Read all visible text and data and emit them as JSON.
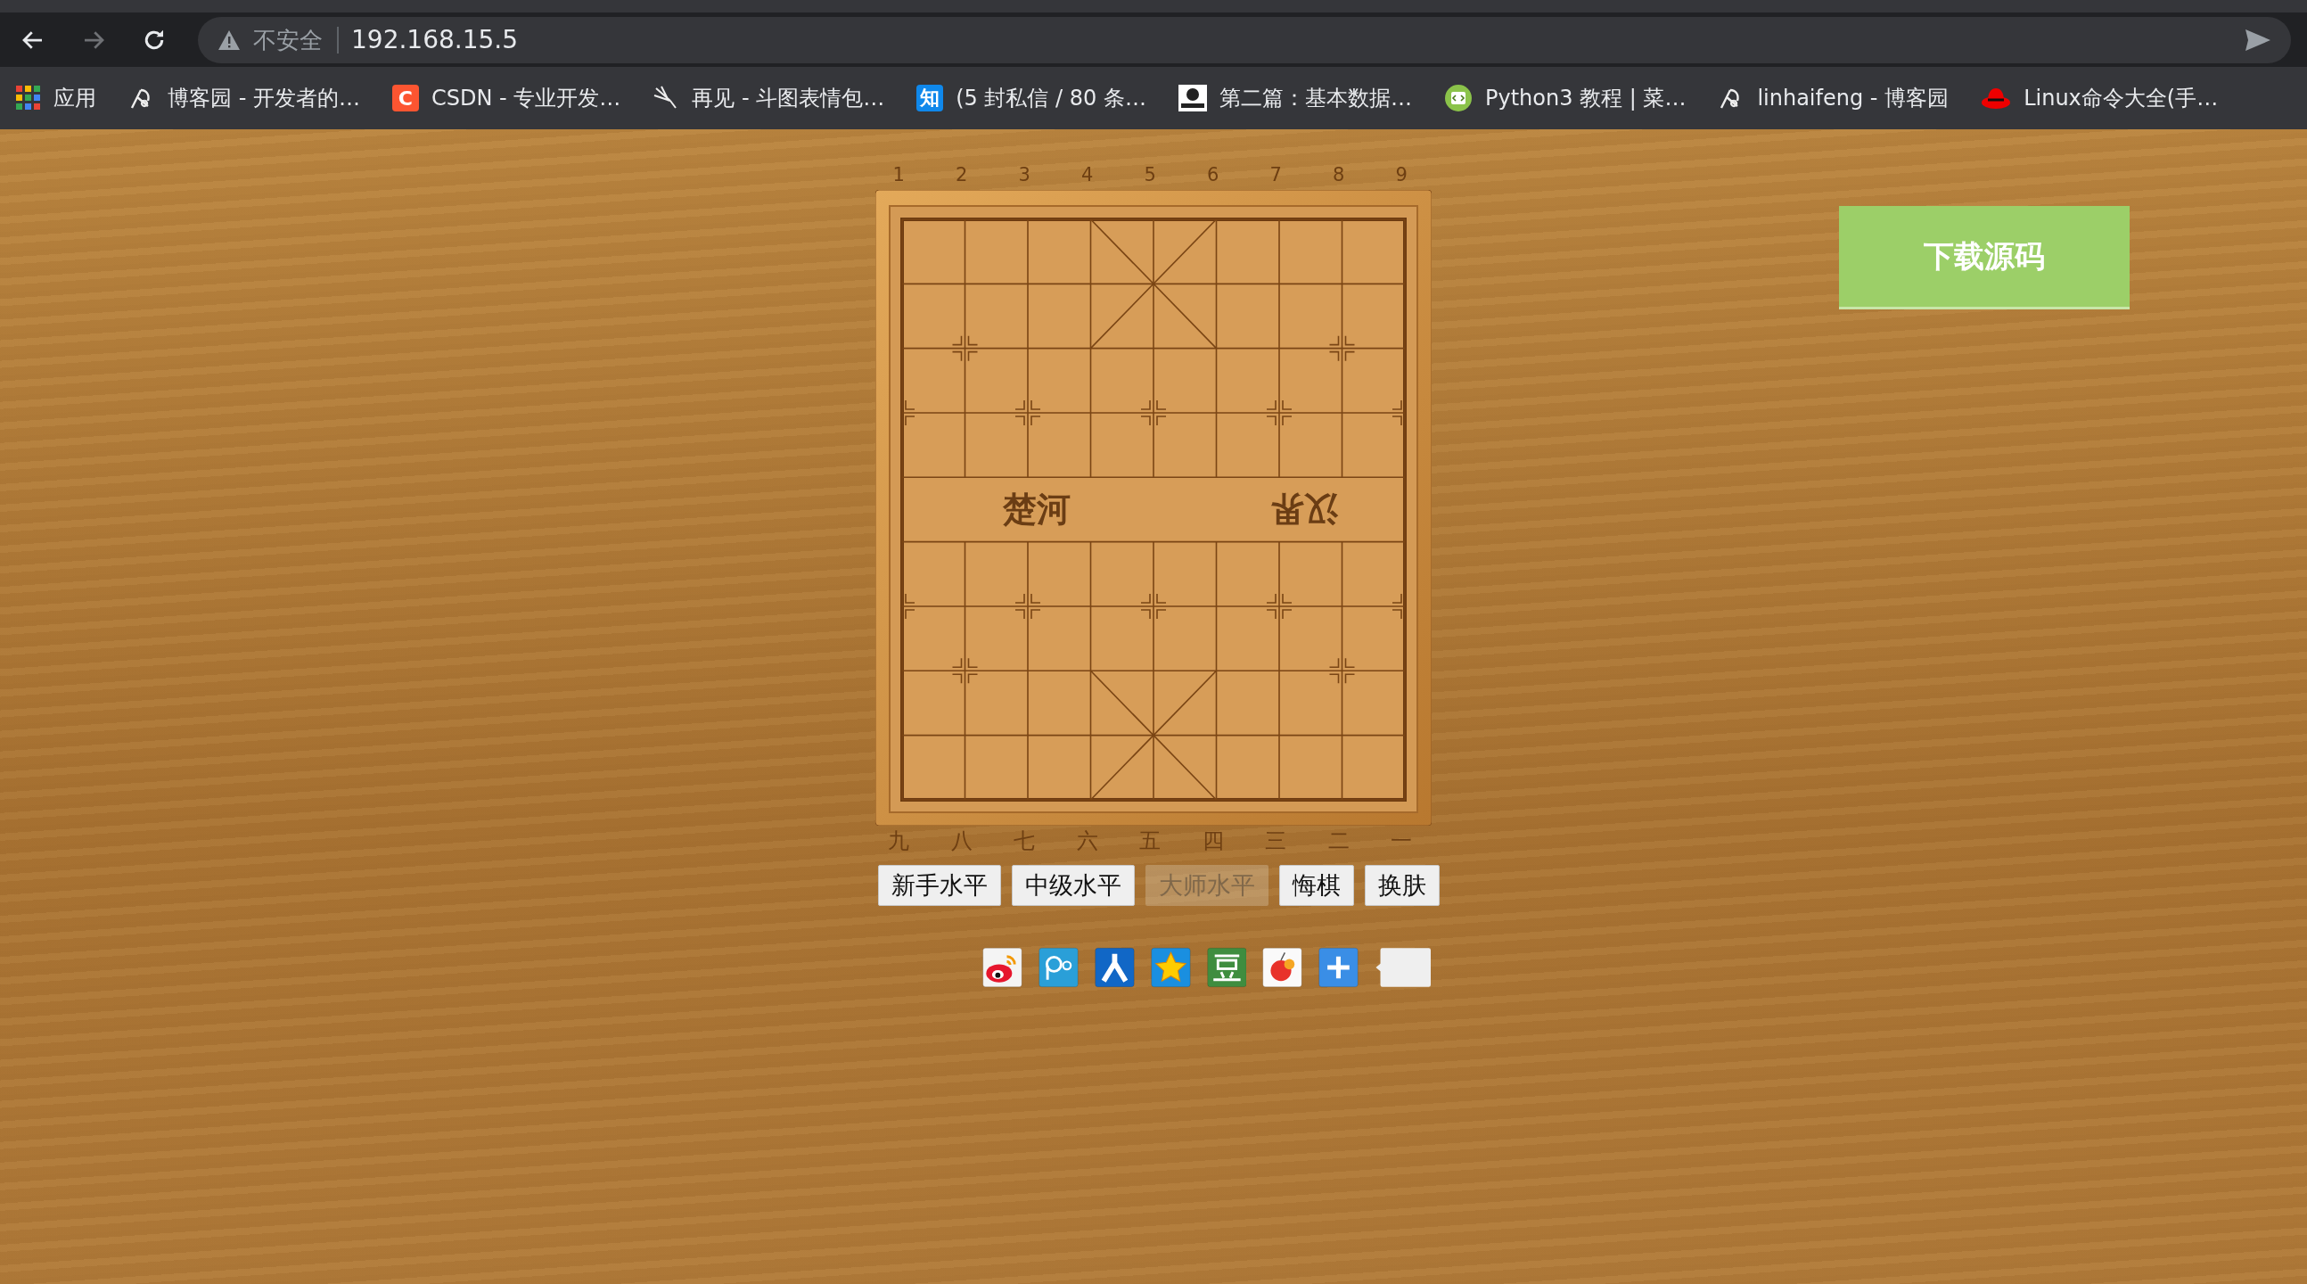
{
  "browser": {
    "nav": [
      {
        "kind": "back",
        "disabled": false
      },
      {
        "kind": "forward",
        "disabled": true
      },
      {
        "kind": "reload",
        "disabled": false
      }
    ],
    "security_label": "不安全",
    "url": "192.168.15.5"
  },
  "bookmarks": [
    {
      "kind": "apps",
      "label": "应用"
    },
    {
      "kind": "pen",
      "label": "博客园 - 开发者的…"
    },
    {
      "kind": "letter",
      "icon_text": "C",
      "color": "#fc5531",
      "label": "CSDN - 专业开发…"
    },
    {
      "kind": "spark",
      "label": "再见 - 斗图表情包…"
    },
    {
      "kind": "letter",
      "icon_text": "知",
      "color": "#0f88eb",
      "label": "(5 封私信 / 80 条…"
    },
    {
      "kind": "thumb",
      "label": "第二篇：基本数据…"
    },
    {
      "kind": "code",
      "label": "Python3 教程 | 菜…"
    },
    {
      "kind": "pen",
      "label": "linhaifeng - 博客园"
    },
    {
      "kind": "hat",
      "label": "Linux命令大全(手…"
    }
  ],
  "board": {
    "top_numbers": [
      "1",
      "2",
      "3",
      "4",
      "5",
      "6",
      "7",
      "8",
      "9"
    ],
    "river_left": "楚河",
    "river_right": "汉界",
    "bottom_numbers": [
      "九",
      "八",
      "七",
      "六",
      "五",
      "四",
      "三",
      "二",
      "一"
    ]
  },
  "controls": [
    {
      "label": "新手水平",
      "disabled": false
    },
    {
      "label": "中级水平",
      "disabled": false
    },
    {
      "label": "大师水平",
      "disabled": true
    },
    {
      "label": "悔棋",
      "disabled": false
    },
    {
      "label": "换肤",
      "disabled": false
    }
  ],
  "share": [
    {
      "kind": "weibo"
    },
    {
      "kind": "rings"
    },
    {
      "kind": "person"
    },
    {
      "kind": "star"
    },
    {
      "kind": "bean"
    },
    {
      "kind": "apple"
    },
    {
      "kind": "plus"
    },
    {
      "kind": "bubble"
    }
  ],
  "download_button": "下载源码"
}
